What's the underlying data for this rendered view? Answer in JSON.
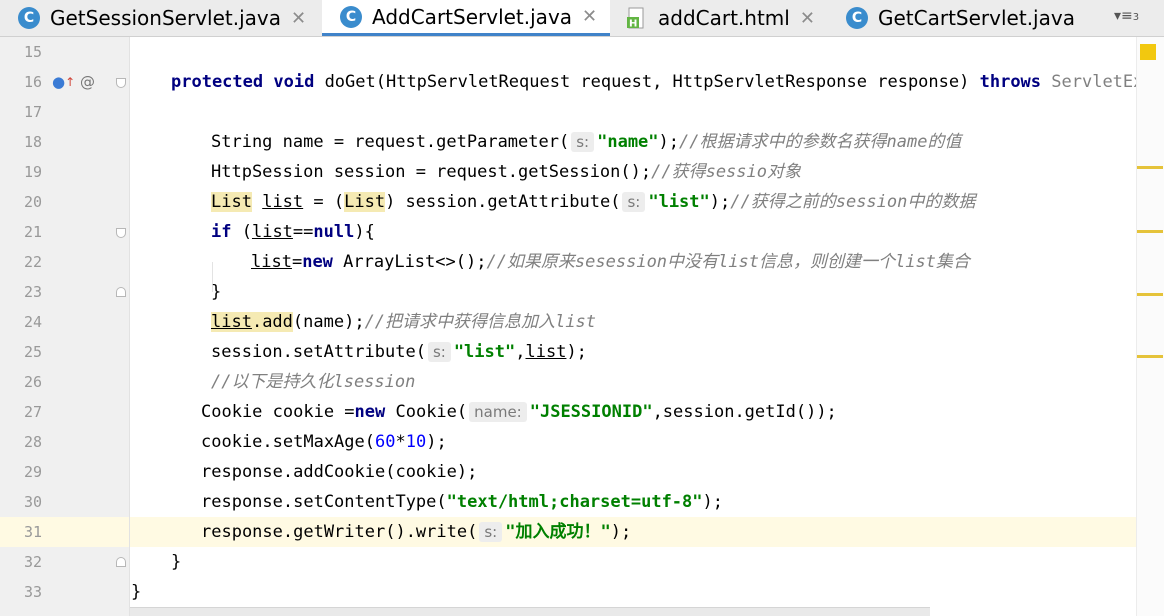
{
  "tabs": [
    {
      "label": "GetSessionServlet.java",
      "icon": "java-class-icon",
      "active": false
    },
    {
      "label": "AddCartServlet.java",
      "icon": "java-class-icon",
      "active": true
    },
    {
      "label": "addCart.html",
      "icon": "html-file-icon",
      "active": false
    },
    {
      "label": "GetCartServlet.java",
      "icon": "java-class-icon",
      "active": false
    }
  ],
  "class_icon_letter": "C",
  "tab_close_glyph": "✕",
  "tab_overflow": {
    "count": "3",
    "icon": "tab-list-icon"
  },
  "current_line": "31",
  "gutter": {
    "override_icon": "override-marker-icon",
    "annotation": "@"
  },
  "lines": [
    {
      "num": "15"
    },
    {
      "num": "16"
    },
    {
      "num": "17"
    },
    {
      "num": "18"
    },
    {
      "num": "19"
    },
    {
      "num": "20"
    },
    {
      "num": "21"
    },
    {
      "num": "22"
    },
    {
      "num": "23"
    },
    {
      "num": "24"
    },
    {
      "num": "25"
    },
    {
      "num": "26"
    },
    {
      "num": "27"
    },
    {
      "num": "28"
    },
    {
      "num": "29"
    },
    {
      "num": "30"
    },
    {
      "num": "31"
    },
    {
      "num": "32"
    },
    {
      "num": "33"
    }
  ],
  "code": {
    "l16": {
      "kw1": "protected",
      "kw2": "void",
      "sig": " doGet(HttpServletRequest request, HttpServletResponse response) ",
      "kw3": "throws",
      "exc": " ServletExcept"
    },
    "l18": {
      "a": "String name = request.getParameter(",
      "hint": "s:",
      "str": "\"name\"",
      "b": ");",
      "cm": "//根据请求中的参数名获得name的值"
    },
    "l19": {
      "a": "HttpSession session = request.getSession();",
      "cm": "//获得sessio对象"
    },
    "l20": {
      "t1": "List",
      "sp": " ",
      "v": "list",
      "eq": " = (",
      "t2": "List",
      "a": ") session.getAttribute(",
      "hint": "s:",
      "str": "\"list\"",
      "b": ");",
      "cm": "//获得之前的session中的数据"
    },
    "l21": {
      "kw": "if",
      "a": " (",
      "v": "list",
      "b": "==",
      "kw2": "null",
      "c": "){"
    },
    "l22": {
      "v": "list",
      "a": "=",
      "kw": "new",
      "b": " ArrayList<>();",
      "cm": "//如果原来sesession中没有list信息，则创建一个list集合"
    },
    "l23": {
      "a": "}"
    },
    "l24": {
      "v": "list",
      "a": ".add",
      "b": "(name);",
      "cm": "//把请求中获得信息加入list"
    },
    "l25": {
      "a": "session.setAttribute(",
      "hint": "s:",
      "str": "\"list\"",
      "b": ",",
      "v": "list",
      "c": ");"
    },
    "l26": {
      "cm": "//以下是持久化lsession"
    },
    "l27": {
      "a": "Cookie cookie =",
      "kw": "new",
      "b": " Cookie(",
      "hint": "name:",
      "str": "\"JSESSIONID\"",
      "c": ",session.getId());"
    },
    "l28": {
      "a": "cookie.setMaxAge(",
      "n1": "60",
      "b": "*",
      "n2": "10",
      "c": ");"
    },
    "l29": {
      "a": "response.addCookie(cookie);"
    },
    "l30": {
      "a": "response.setContentType(",
      "str": "\"text/html;charset=utf-8\"",
      "b": ");"
    },
    "l31": {
      "a": "response.getWriter().write(",
      "hint": "s:",
      "str": "\"加入成功！\"",
      "b": ");"
    },
    "l32": {
      "a": "}"
    },
    "l33": {
      "a": "}"
    }
  },
  "colors": {
    "keyword": "#000080",
    "string": "#008000",
    "comment": "#808080",
    "number": "#0000ff",
    "current_line_bg": "#fffae3",
    "active_tab_underline": "#4083c9",
    "warning": "#f2c80f"
  }
}
